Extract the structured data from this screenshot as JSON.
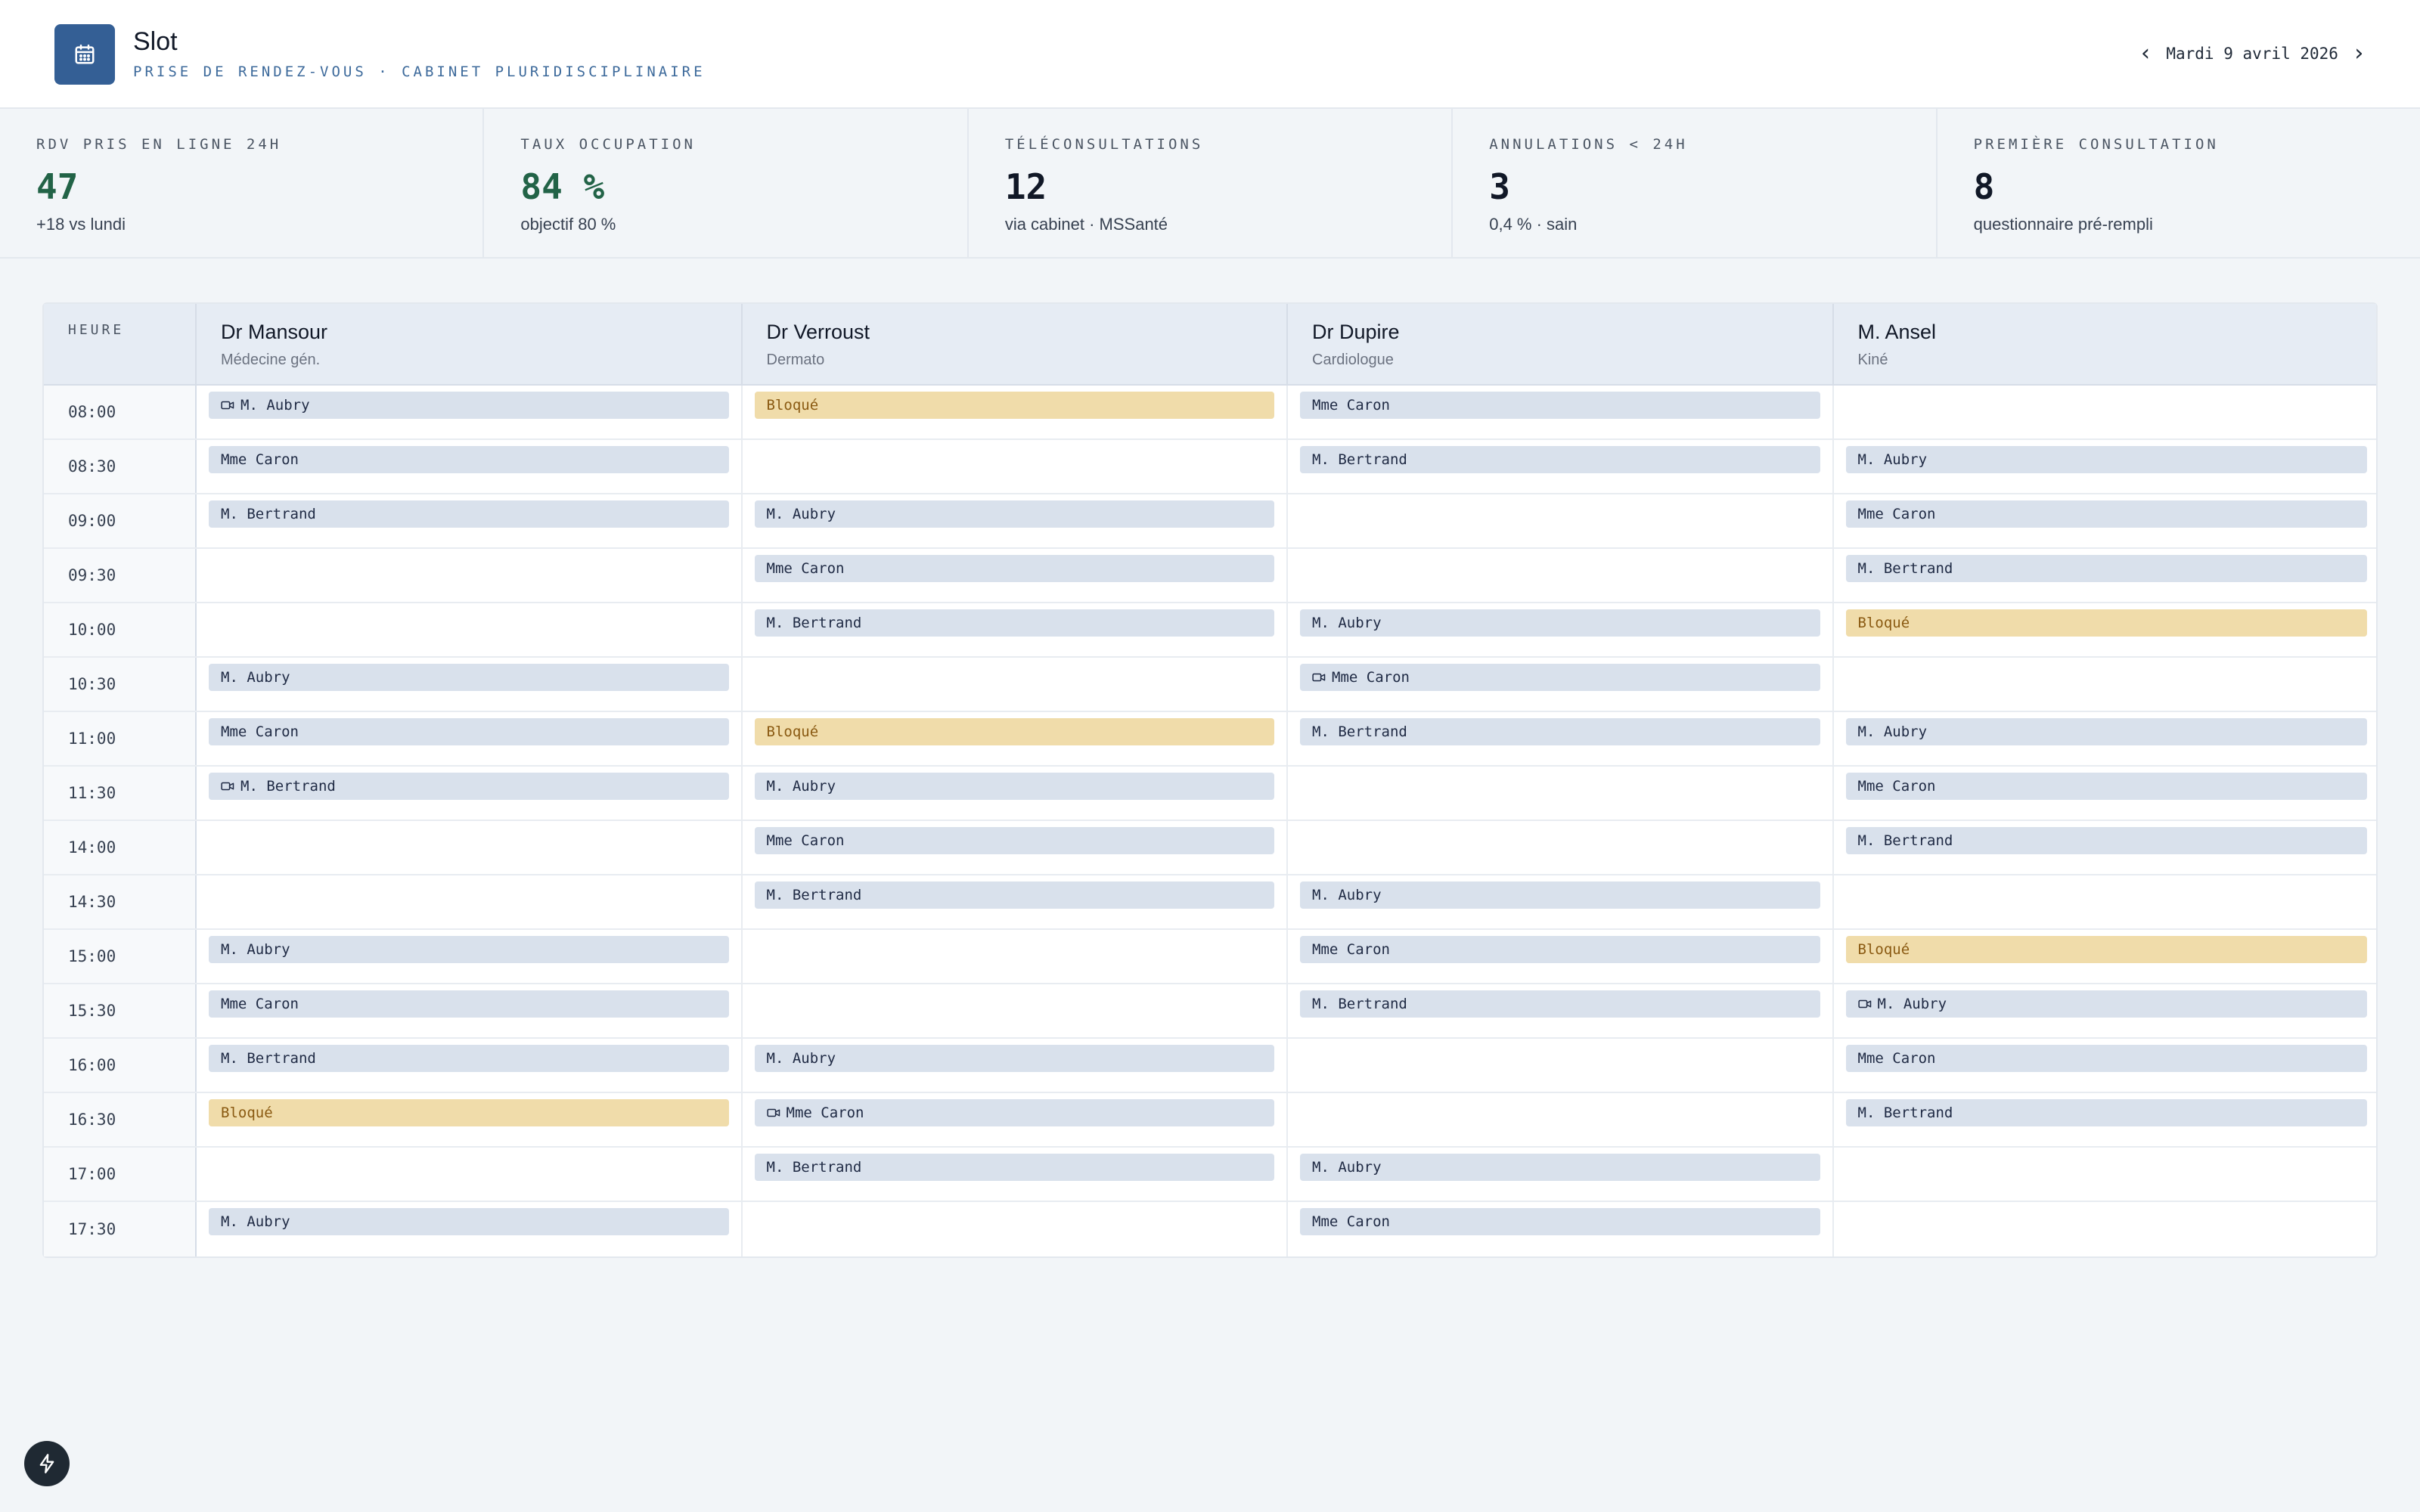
{
  "app": {
    "title": "Slot",
    "subtitle": "PRISE DE RENDEZ-VOUS · CABINET PLURIDISCIPLINAIRE",
    "date": "Mardi 9 avril 2026",
    "logo_icon": "calendar-icon",
    "prev_icon": "chevron-left-icon",
    "next_icon": "chevron-right-icon"
  },
  "kpis": [
    {
      "label": "RDV PRIS EN LIGNE 24H",
      "value": "47",
      "sub": "+18 vs lundi",
      "accent": "#226347"
    },
    {
      "label": "TAUX OCCUPATION",
      "value": "84 %",
      "sub": "objectif 80 %",
      "accent": "#226347"
    },
    {
      "label": "TÉLÉCONSULTATIONS",
      "value": "12",
      "sub": "via cabinet · MSSanté",
      "accent": "#111827"
    },
    {
      "label": "ANNULATIONS < 24H",
      "value": "3",
      "sub": "0,4 % · sain",
      "accent": "#111827"
    },
    {
      "label": "PREMIÈRE CONSULTATION",
      "value": "8",
      "sub": "questionnaire pré-rempli",
      "accent": "#111827"
    }
  ],
  "schedule": {
    "time_header": "HEURE",
    "practitioners": [
      {
        "name": "Dr Mansour",
        "specialty": "Médecine gén."
      },
      {
        "name": "Dr Verroust",
        "specialty": "Dermato"
      },
      {
        "name": "Dr Dupire",
        "specialty": "Cardiologue"
      },
      {
        "name": "M. Ansel",
        "specialty": "Kiné"
      }
    ],
    "rows": [
      {
        "time": "08:00",
        "slots": [
          {
            "text": "M. Aubry",
            "type": "video"
          },
          {
            "text": "Bloqué",
            "type": "blocked"
          },
          {
            "text": "Mme Caron",
            "type": "normal"
          },
          null
        ]
      },
      {
        "time": "08:30",
        "slots": [
          {
            "text": "Mme Caron",
            "type": "normal"
          },
          null,
          {
            "text": "M. Bertrand",
            "type": "normal"
          },
          {
            "text": "M. Aubry",
            "type": "normal"
          }
        ]
      },
      {
        "time": "09:00",
        "slots": [
          {
            "text": "M. Bertrand",
            "type": "normal"
          },
          {
            "text": "M. Aubry",
            "type": "normal"
          },
          null,
          {
            "text": "Mme Caron",
            "type": "normal"
          }
        ]
      },
      {
        "time": "09:30",
        "slots": [
          null,
          {
            "text": "Mme Caron",
            "type": "normal"
          },
          null,
          {
            "text": "M. Bertrand",
            "type": "normal"
          }
        ]
      },
      {
        "time": "10:00",
        "slots": [
          null,
          {
            "text": "M. Bertrand",
            "type": "normal"
          },
          {
            "text": "M. Aubry",
            "type": "normal"
          },
          {
            "text": "Bloqué",
            "type": "blocked"
          }
        ]
      },
      {
        "time": "10:30",
        "slots": [
          {
            "text": "M. Aubry",
            "type": "normal"
          },
          null,
          {
            "text": "Mme Caron",
            "type": "video"
          },
          null
        ]
      },
      {
        "time": "11:00",
        "slots": [
          {
            "text": "Mme Caron",
            "type": "normal"
          },
          {
            "text": "Bloqué",
            "type": "blocked"
          },
          {
            "text": "M. Bertrand",
            "type": "normal"
          },
          {
            "text": "M. Aubry",
            "type": "normal"
          }
        ]
      },
      {
        "time": "11:30",
        "slots": [
          {
            "text": "M. Bertrand",
            "type": "video"
          },
          {
            "text": "M. Aubry",
            "type": "normal"
          },
          null,
          {
            "text": "Mme Caron",
            "type": "normal"
          }
        ]
      },
      {
        "time": "14:00",
        "slots": [
          null,
          {
            "text": "Mme Caron",
            "type": "normal"
          },
          null,
          {
            "text": "M. Bertrand",
            "type": "normal"
          }
        ]
      },
      {
        "time": "14:30",
        "slots": [
          null,
          {
            "text": "M. Bertrand",
            "type": "normal"
          },
          {
            "text": "M. Aubry",
            "type": "normal"
          },
          null
        ]
      },
      {
        "time": "15:00",
        "slots": [
          {
            "text": "M. Aubry",
            "type": "normal"
          },
          null,
          {
            "text": "Mme Caron",
            "type": "normal"
          },
          {
            "text": "Bloqué",
            "type": "blocked"
          }
        ]
      },
      {
        "time": "15:30",
        "slots": [
          {
            "text": "Mme Caron",
            "type": "normal"
          },
          null,
          {
            "text": "M. Bertrand",
            "type": "normal"
          },
          {
            "text": "M. Aubry",
            "type": "video"
          }
        ]
      },
      {
        "time": "16:00",
        "slots": [
          {
            "text": "M. Bertrand",
            "type": "normal"
          },
          {
            "text": "M. Aubry",
            "type": "normal"
          },
          null,
          {
            "text": "Mme Caron",
            "type": "normal"
          }
        ]
      },
      {
        "time": "16:30",
        "slots": [
          {
            "text": "Bloqué",
            "type": "blocked"
          },
          {
            "text": "Mme Caron",
            "type": "video"
          },
          null,
          {
            "text": "M. Bertrand",
            "type": "normal"
          }
        ]
      },
      {
        "time": "17:00",
        "slots": [
          null,
          {
            "text": "M. Bertrand",
            "type": "normal"
          },
          {
            "text": "M. Aubry",
            "type": "normal"
          },
          null
        ]
      },
      {
        "time": "17:30",
        "slots": [
          {
            "text": "M. Aubry",
            "type": "normal"
          },
          null,
          {
            "text": "Mme Caron",
            "type": "normal"
          },
          null
        ]
      }
    ]
  },
  "colors": {
    "brand": "#345f95",
    "appointment_bg": "#d9e1ec",
    "blocked_bg": "#f0dcaa",
    "blocked_text": "#8a5a12",
    "positive": "#226347"
  },
  "fab_icon": "bolt-icon"
}
